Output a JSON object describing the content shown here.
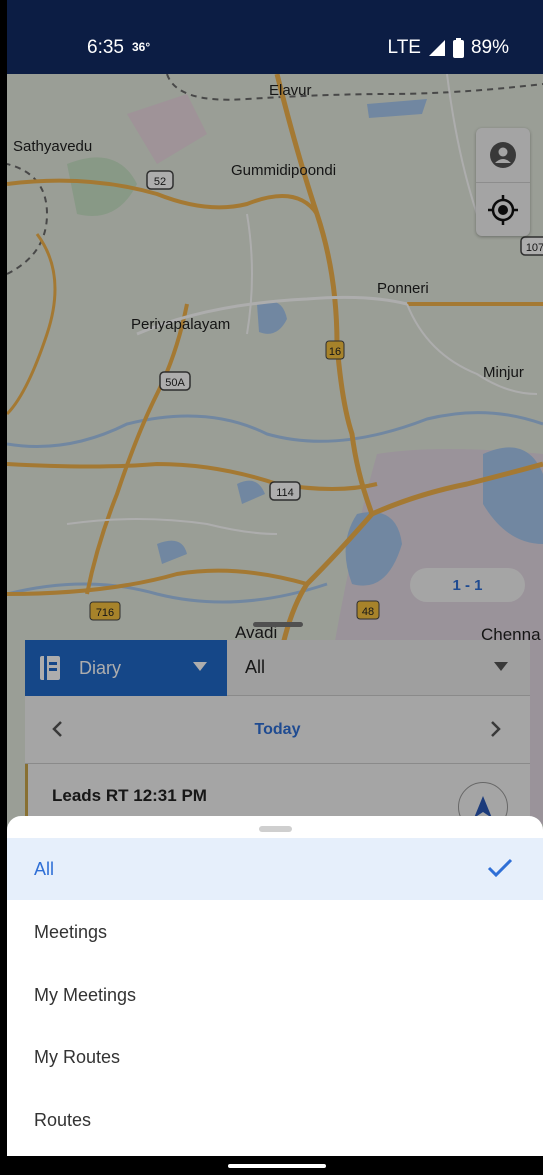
{
  "status_bar": {
    "time": "6:35",
    "temperature": "36°",
    "network": "LTE",
    "battery": "89%"
  },
  "map": {
    "places": [
      "Elavur",
      "Sathyavedu",
      "Gummidipoondi",
      "Ponneri",
      "Periyapalayam",
      "Minjur",
      "Avadi",
      "Chenna"
    ],
    "road_shields": [
      "52",
      "16",
      "50A",
      "114",
      "716",
      "48",
      "107"
    ],
    "controls": {
      "profile_icon": "account-circle-icon",
      "locate_icon": "my-location-icon"
    },
    "pager": "1 - 1"
  },
  "panel": {
    "diary_label": "Diary",
    "filter_value": "All",
    "date_label": "Today",
    "item_title": "Leads RT 12:31 PM"
  },
  "sheet": {
    "options": [
      "All",
      "Meetings",
      "My Meetings",
      "My Routes",
      "Routes"
    ],
    "selected": "All"
  },
  "colors": {
    "status_bar": "#0c1d44",
    "accent": "#2f6fd6",
    "diary_tab": "#1f69c9",
    "selected_row": "#e6effb"
  }
}
